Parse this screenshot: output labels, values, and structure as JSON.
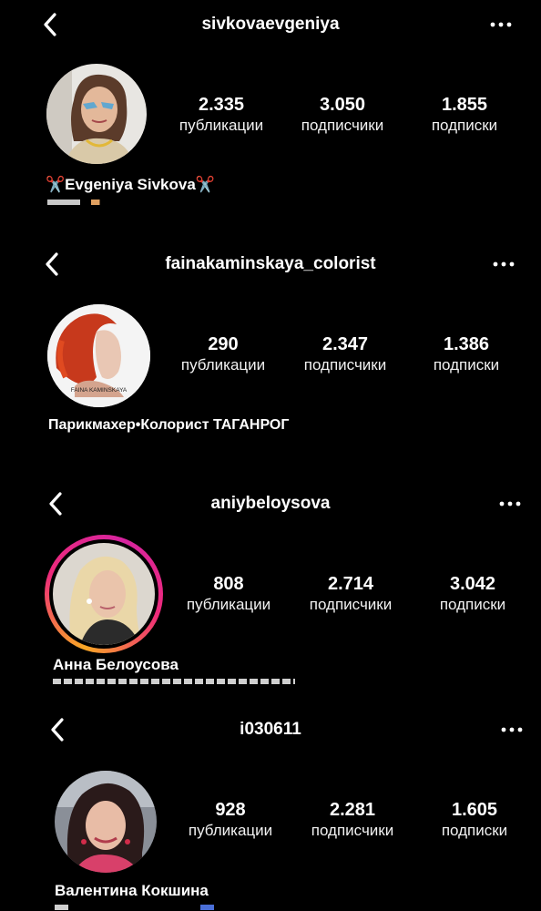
{
  "profiles": [
    {
      "username": "sivkovaevgeniya",
      "stats": [
        {
          "value": "2.335",
          "label": "публикации"
        },
        {
          "value": "3.050",
          "label": "подписчики"
        },
        {
          "value": "1.855",
          "label": "подписки"
        }
      ],
      "name_prefix": "✂️",
      "name": "Evgeniya Sivkova",
      "name_suffix": "✂️",
      "avatar_story_ring": false
    },
    {
      "username": "fainakaminskaya_colorist",
      "stats": [
        {
          "value": "290",
          "label": "публикации"
        },
        {
          "value": "2.347",
          "label": "подписчики"
        },
        {
          "value": "1.386",
          "label": "подписки"
        }
      ],
      "name": "Парикмахер•Колорист ТАГАНРОГ",
      "avatar_caption": "FAINA KAMINSKAYA",
      "avatar_story_ring": false
    },
    {
      "username": "aniybeloysova",
      "stats": [
        {
          "value": "808",
          "label": "публикации"
        },
        {
          "value": "2.714",
          "label": "подписчики"
        },
        {
          "value": "3.042",
          "label": "подписки"
        }
      ],
      "name": "Анна Белоусова",
      "avatar_story_ring": true
    },
    {
      "username": "i030611",
      "stats": [
        {
          "value": "928",
          "label": "публикации"
        },
        {
          "value": "2.281",
          "label": "подписчики"
        },
        {
          "value": "1.605",
          "label": "подписки"
        }
      ],
      "name": "Валентина Кокшина",
      "avatar_story_ring": false
    }
  ],
  "icons": {
    "back": "chevron-left-icon",
    "more": "more-horizontal-icon"
  },
  "colors": {
    "background": "#000000",
    "text": "#ffffff",
    "story_ring_start": "#f9a825",
    "story_ring_end": "#d6249f"
  }
}
